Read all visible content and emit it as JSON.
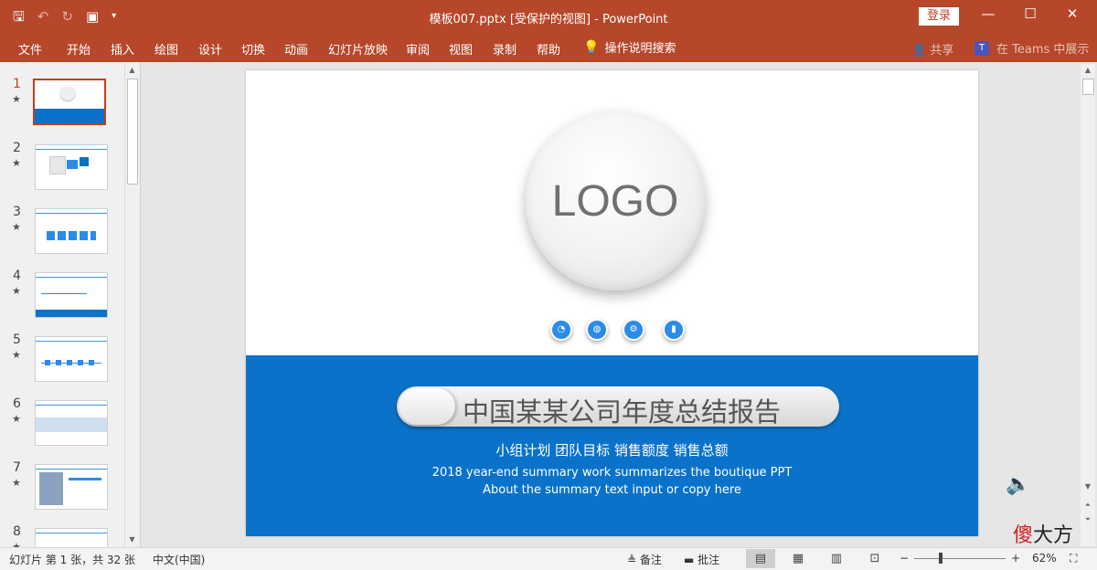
{
  "window": {
    "title": "模板007.pptx [受保护的视图] - PowerPoint",
    "login_label": "登录",
    "qat_icons": [
      "save-icon",
      "undo-icon",
      "redo-icon",
      "present-icon",
      "customize-icon"
    ],
    "controls": {
      "minimize": "—",
      "restore": "☐",
      "close": "✕"
    }
  },
  "menu": {
    "items": [
      "文件",
      "开始",
      "插入",
      "绘图",
      "设计",
      "切换",
      "动画",
      "幻灯片放映",
      "审阅",
      "视图",
      "录制",
      "帮助"
    ],
    "tell_me": "操作说明搜索",
    "share": "共享",
    "teams": "在 Teams 中展示"
  },
  "thumbnails": {
    "numbers": [
      "1",
      "2",
      "3",
      "4",
      "5",
      "6",
      "7",
      "8"
    ],
    "active": "1",
    "star": "★"
  },
  "slide": {
    "logo_text": "LOGO",
    "title": "中国某某公司年度总结报告",
    "subtitle_cn": "小组计划   团队目标   销售额度   销售总额",
    "line1": "2018 year-end summary work summarizes the boutique PPT",
    "line2": "About the summary text input or copy here",
    "icons": [
      "chart-pie-icon",
      "globe-icon",
      "gears-icon",
      "bar-chart-icon"
    ],
    "band_color": "#0b72c9"
  },
  "status": {
    "slide_info": "幻灯片 第 1 张，共 32 张",
    "language": "中文(中国)",
    "notes": "备注",
    "comments": "批注",
    "zoom": "62%",
    "zoom_minus": "−",
    "zoom_plus": "+"
  },
  "watermark": {
    "left": "傻",
    "right": "大方"
  }
}
